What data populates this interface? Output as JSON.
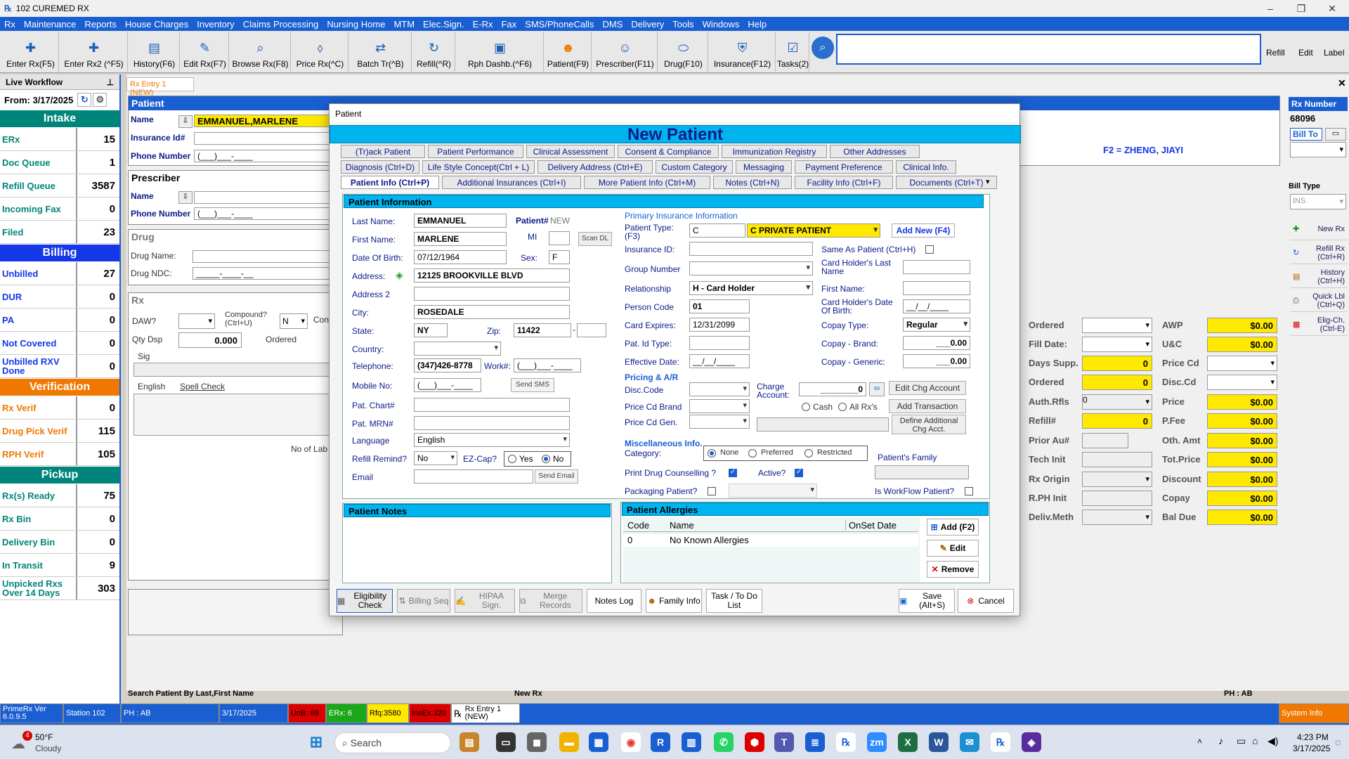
{
  "window": {
    "title": "102 CUREMED RX"
  },
  "menu": [
    "Rx",
    "Maintenance",
    "Reports",
    "House Charges",
    "Inventory",
    "Claims Processing",
    "Nursing Home",
    "MTM",
    "Elec.Sign.",
    "E-Rx",
    "Fax",
    "SMS/PhoneCalls",
    "DMS",
    "Delivery",
    "Tools",
    "Windows",
    "Help"
  ],
  "toolbar": {
    "buttons": [
      {
        "label": "Enter Rx(F5)",
        "icon": "rx-add-icon"
      },
      {
        "label": "Enter Rx2 (^F5)",
        "icon": "rx-add-icon"
      },
      {
        "label": "History(F6)",
        "icon": "folder-icon"
      },
      {
        "label": "Edit Rx(F7)",
        "icon": "pencil-icon"
      },
      {
        "label": "Browse Rx(F8)",
        "icon": "magnifier-icon"
      },
      {
        "label": "Price Rx(^C)",
        "icon": "price-tag-icon"
      },
      {
        "label": "Batch Tr(^B)",
        "icon": "batch-icon"
      },
      {
        "label": "Refill(^R)",
        "icon": "refill-icon"
      },
      {
        "label": "Rph Dashb.(^F6)",
        "icon": "dashboard-icon"
      },
      {
        "label": "Patient(F9)",
        "icon": "patient-icon"
      },
      {
        "label": "Prescriber(F11)",
        "icon": "doctor-icon"
      },
      {
        "label": "Drug(F10)",
        "icon": "pill-icon"
      },
      {
        "label": "Insurance(F12)",
        "icon": "shield-icon"
      },
      {
        "label": "Tasks(2)",
        "icon": "tasks-icon"
      }
    ],
    "right_labels": [
      "Refill",
      "Edit",
      "Label"
    ]
  },
  "left": {
    "header": "Live Workflow",
    "from_label": "From:",
    "from_date": "3/17/2025",
    "sections": [
      {
        "title": "Intake",
        "color": "#00857a",
        "rows": [
          {
            "label": "ERx",
            "value": "15",
            "color": "#00857a"
          },
          {
            "label": "Doc Queue",
            "value": "1",
            "color": "#00857a"
          },
          {
            "label": "Refill Queue",
            "value": "3587",
            "color": "#00857a"
          },
          {
            "label": "Incoming Fax",
            "value": "0",
            "color": "#00857a"
          },
          {
            "label": "Filed",
            "value": "23",
            "color": "#00857a"
          }
        ]
      },
      {
        "title": "Billing",
        "color": "#1437e8",
        "rows": [
          {
            "label": "Unbilled",
            "value": "27",
            "color": "#1437e8"
          },
          {
            "label": "DUR",
            "value": "0",
            "color": "#1437e8"
          },
          {
            "label": "PA",
            "value": "0",
            "color": "#1437e8"
          },
          {
            "label": "Not Covered",
            "value": "0",
            "color": "#1437e8"
          },
          {
            "label": "Unbilled RXV Done",
            "value": "0",
            "color": "#1437e8"
          }
        ]
      },
      {
        "title": "Verification",
        "color": "#f07800",
        "rows": [
          {
            "label": "Rx Verif",
            "value": "0",
            "color": "#f07800"
          },
          {
            "label": "Drug Pick Verif",
            "value": "115",
            "color": "#f07800"
          },
          {
            "label": "RPH Verif",
            "value": "105",
            "color": "#f07800"
          }
        ]
      },
      {
        "title": "Pickup",
        "color": "#00857a",
        "rows": [
          {
            "label": "Rx(s) Ready",
            "value": "75",
            "color": "#00857a"
          },
          {
            "label": "Rx Bin",
            "value": "0",
            "color": "#00857a"
          },
          {
            "label": "Delivery Bin",
            "value": "0",
            "color": "#00857a"
          },
          {
            "label": "In Transit",
            "value": "9",
            "color": "#00857a"
          },
          {
            "label": "Unpicked Rxs Over 14 Days",
            "value": "303",
            "color": "#00857a"
          }
        ]
      }
    ]
  },
  "bg": {
    "tab": "Rx Entry 1 (NEW)",
    "patient_head": "Patient",
    "name_label": "Name",
    "name_value": "EMMANUEL,MARLENE",
    "ins_label": "Insurance Id#",
    "phone_label": "Phone Number",
    "phone_value": "(___)___-____",
    "prescriber_head": "Prescriber",
    "pname_label": "Name",
    "pphone_label": "Phone Number",
    "pphone_value": "(___)___-____",
    "drug_head": "Drug",
    "drug_name_label": "Drug Name:",
    "drug_ndc_label": "Drug NDC:",
    "drug_ndc_value": "_____-____-__",
    "rx_head": "Rx",
    "daw_label": "DAW?",
    "compound_label": "Compound? (Ctrl+U)",
    "compound_value": "N",
    "con_label": "Con",
    "qty_label": "Qty Dsp",
    "qty_value": "0.000",
    "ordered_label": "Ordered",
    "sig_label": "Sig",
    "english_label": "English",
    "spell_label": "Spell Check",
    "no_lab": "No of Lab",
    "search_hint": "Search Patient By Last,First Name",
    "new_rx": "New Rx",
    "ph": "PH : AB",
    "rxnumber_label": "Rx Number",
    "rxnumber_value": "68096",
    "billto_label": "Bill To",
    "f2_text": "F2 = ZHENG, JIAYI",
    "billtype_label": "Bill Type",
    "billtype_value": "INS"
  },
  "rightcol": {
    "left_labels": [
      "Ordered",
      "Fill Date:",
      "Days Supp.",
      "Ordered",
      "Auth.Rfls",
      "Refill#",
      "Prior Au#",
      "Tech Init",
      "Rx Origin",
      "R.PH Init",
      "Deliv.Meth"
    ],
    "left_values": [
      "",
      "",
      "0",
      "0",
      "0",
      "0",
      "",
      "",
      "",
      "",
      ""
    ],
    "price_labels": [
      "AWP",
      "U&C",
      "Price Cd",
      "Disc.Cd",
      "Price",
      "P.Fee",
      "Oth. Amt",
      "Tot.Price",
      "Discount",
      "Copay",
      "Bal Due"
    ],
    "price_values": [
      "$0.00",
      "$0.00",
      "",
      "",
      "$0.00",
      "$0.00",
      "$0.00",
      "$0.00",
      "$0.00",
      "$0.00",
      "$0.00"
    ],
    "side_buttons": [
      "New Rx",
      "Refill Rx (Ctrl+R)",
      "History (Ctrl+H)",
      "Quick Lbl (Ctrl+Q)",
      "Elig-Ch. (Ctrl-E)"
    ]
  },
  "modal": {
    "title": "Patient",
    "banner": "New Patient",
    "tabs_row1": [
      "(Tr)ack Patient",
      "Patient Performance",
      "Clinical Assessment",
      "Consent & Compliance",
      "Immunization Registry",
      "Other Addresses"
    ],
    "tabs_row2": [
      "Diagnosis (Ctrl+D)",
      "Life Style Concept(Ctrl + L)",
      "Delivery Address (Ctrl+E)",
      "Custom Category",
      "Messaging",
      "Payment Preference",
      "Clinical Info."
    ],
    "tabs_row3": [
      "Patient Info (Ctrl+P)",
      "Additional Insurances (Ctrl+I)",
      "More Patient Info (Ctrl+M)",
      "Notes (Ctrl+N)",
      "Facility Info (Ctrl+F)",
      "Documents (Ctrl+T)"
    ],
    "pi_head": "Patient Information",
    "last_name_label": "Last Name:",
    "last_name": "EMMANUEL",
    "patient_no_label": "Patient#",
    "patient_no": "NEW",
    "first_name_label": "First Name:",
    "first_name": "MARLENE",
    "mi_label": "MI",
    "scan_dl": "Scan DL",
    "dob_label": "Date Of Birth:",
    "dob": "07/12/1964",
    "sex_label": "Sex:",
    "sex": "F",
    "address_label": "Address:",
    "address": "12125 BROOKVILLE BLVD",
    "address2_label": "Address 2",
    "city_label": "City:",
    "city": "ROSEDALE",
    "state_label": "State:",
    "state": "NY",
    "zip_label": "Zip:",
    "zip": "11422",
    "country_label": "Country:",
    "tel_label": "Telephone:",
    "tel": "(347)426-8778",
    "work_label": "Work#:",
    "work": "(___)___-____",
    "mobile_label": "Mobile No:",
    "mobile": "(___)___-____",
    "send_sms": "Send SMS",
    "chart_label": "Pat. Chart#",
    "mrn_label": "Pat. MRN#",
    "lang_label": "Language",
    "lang": "English",
    "refill_label": "Refill Remind?",
    "refill": "No",
    "ezcap_label": "EZ-Cap?",
    "yes": "Yes",
    "no": "No",
    "email_label": "Email",
    "send_email": "Send Email",
    "ins_head": "Primary Insurance Information",
    "ptype_label": "Patient Type: (F3)",
    "ptype_code": "C",
    "ptype_name": "C      PRIVATE PATIENT",
    "add_new": "Add New (F4)",
    "insid_label": "Insurance ID:",
    "same_label": "Same As Patient (Ctrl+H)",
    "group_label": "Group Number",
    "chlast_label": "Card Holder's Last Name",
    "rel_label": "Relationship",
    "rel": "H - Card Holder",
    "chfirst_label": "First Name:",
    "pcode_label": "Person Code",
    "pcode": "01",
    "chdob_label": "Card Holder's Date Of Birth:",
    "chdob": "__/__/____",
    "cexp_label": "Card Expires:",
    "cexp": "12/31/2099",
    "copaytype_label": "Copay Type:",
    "copaytype": "Regular",
    "patid_label": "Pat. Id Type:",
    "copayb_label": "Copay - Brand:",
    "copayb": "___0.00",
    "effdate_label": "Effective Date:",
    "effdate": "__/__/____",
    "copayg_label": "Copay - Generic:",
    "copayg": "___0.00",
    "pricing_head": "Pricing & A/R",
    "disc_label": "Disc.Code",
    "charge_label": "Charge Account:",
    "charge": "________0",
    "edit_chg": "Edit Chg Account",
    "pcb_label": "Price Cd Brand",
    "cash_label": "Cash",
    "allrx_label": "All Rx's",
    "add_trans": "Add Transaction",
    "pcg_label": "Price Cd Gen.",
    "define_chg": "Define Additional Chg Acct.",
    "misc_head": "Miscellaneous Info.",
    "cat_label": "Category:",
    "none": "None",
    "preferred": "Preferred",
    "restricted": "Restricted",
    "family_label": "Patient's Family",
    "pdc_label": "Print Drug Counselling ?",
    "active_label": "Active?",
    "pkg_label": "Packaging Patient?",
    "wf_label": "Is WorkFlow Patient?",
    "notes_head": "Patient Notes",
    "allergy_head": "Patient Allergies",
    "allergy_cols": [
      "Code",
      "Name",
      "OnSet Date"
    ],
    "allergy_rows": [
      {
        "code": "0",
        "name": "No Known Allergies",
        "date": ""
      }
    ],
    "add_allergy": "Add (F2)",
    "edit_allergy": "Edit",
    "remove_allergy": "Remove",
    "bottom": [
      "Eligibility Check",
      "Billing Seq",
      "HIPAA Sign.",
      "Merge Records",
      "Notes Log",
      "Family Info",
      "Task / To Do List"
    ],
    "save": "Save (Alt+S)",
    "cancel": "Cancel"
  },
  "status": {
    "ver": "PrimeRx Ver 6.0.9.5",
    "station": "Station 102",
    "ph": "PH : AB",
    "date": "3/17/2025",
    "unb": "UnB: 69",
    "erx": "ERx: 6",
    "rfq": "Rfq:3580",
    "insex": "InsEx:320",
    "rxentry": "Rx Entry 1 (NEW)",
    "sysinfo": "System Info"
  },
  "taskbar": {
    "weather_temp": "50°F",
    "weather_desc": "Cloudy",
    "weather_badge": "4",
    "search": "Search",
    "time": "4:23 PM",
    "date": "3/17/2025"
  }
}
